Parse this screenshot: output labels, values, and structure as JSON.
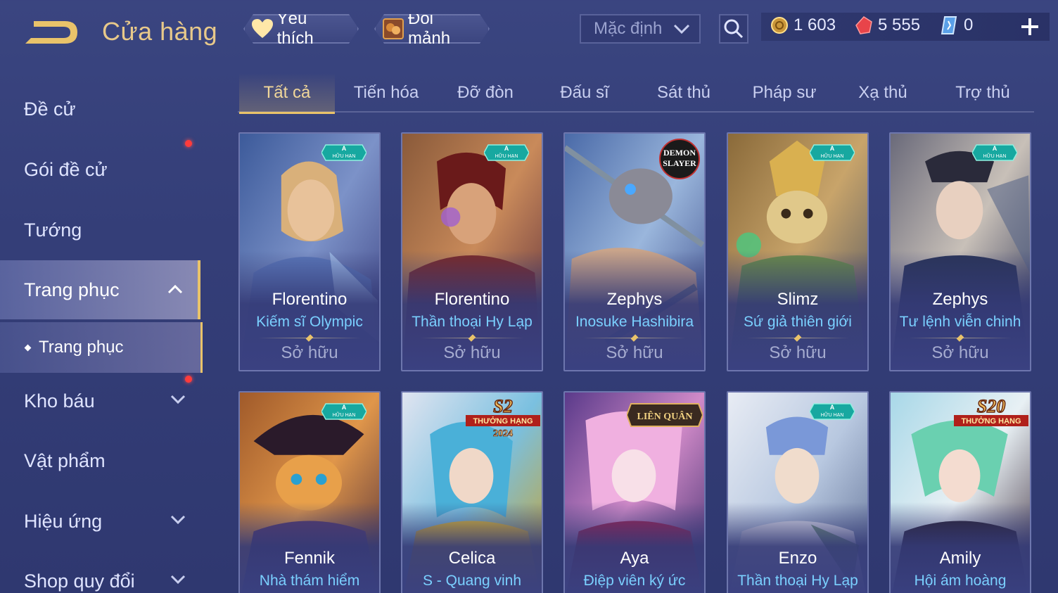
{
  "header": {
    "title": "Cửa hàng",
    "favorite_label": "Yêu thích",
    "fragment_label": "Đổi mảnh",
    "sort_value": "Mặc định"
  },
  "currencies": {
    "gold": "1 603",
    "ruby": "5 555",
    "ticket": "0"
  },
  "sidebar": {
    "items": [
      {
        "label": "Đề cử"
      },
      {
        "label": "Gói đề cử"
      },
      {
        "label": "Tướng"
      },
      {
        "label": "Trang phục"
      },
      {
        "label": "Kho báu"
      },
      {
        "label": "Vật phẩm"
      },
      {
        "label": "Hiệu ứng"
      },
      {
        "label": "Shop quy đổi"
      }
    ],
    "sub_item": "Trang phục"
  },
  "tabs": [
    "Tất cả",
    "Tiến hóa",
    "Đỡ đòn",
    "Đấu sĩ",
    "Sát thủ",
    "Pháp sư",
    "Xạ thủ",
    "Trợ thủ"
  ],
  "cards_row1": [
    {
      "hero": "Florentino",
      "skin": "Kiếm sĩ Olympic",
      "status": "Sở hữu"
    },
    {
      "hero": "Florentino",
      "skin": "Thần thoại Hy Lạp",
      "status": "Sở hữu"
    },
    {
      "hero": "Zephys",
      "skin": "Inosuke Hashibira",
      "status": "Sở hữu"
    },
    {
      "hero": "Slimz",
      "skin": "Sứ giả thiên giới",
      "status": "Sở hữu"
    },
    {
      "hero": "Zephys",
      "skin": "Tư lệnh viễn chinh",
      "status": "Sở hữu"
    }
  ],
  "cards_row2": [
    {
      "hero": "Fennik",
      "skin": "Nhà thám hiểm"
    },
    {
      "hero": "Celica",
      "skin": "S - Quang vinh"
    },
    {
      "hero": "Aya",
      "skin": "Điệp viên ký ức"
    },
    {
      "hero": "Enzo",
      "skin": "Thần thoại Hy Lạp"
    },
    {
      "hero": "Amily",
      "skin": "Hội ám hoàng"
    }
  ],
  "badges": {
    "limited_letter": "A",
    "limited_text": "HỮU HẠN",
    "demon_slayer_l1": "DEMON",
    "demon_slayer_l2": "SLAYER",
    "s2_title": "S2",
    "s2_sub": "THƯỞNG HẠNG",
    "s2_year": "2024",
    "s20_title": "S20",
    "s20_sub": "THƯỞNG HẠNG",
    "lienquan": "LIÊN QUÂN"
  },
  "colors": {
    "accent_gold": "#e9c36a",
    "skin_name_blue": "#7ad0ff",
    "badge_red": "#ff3b3b"
  }
}
